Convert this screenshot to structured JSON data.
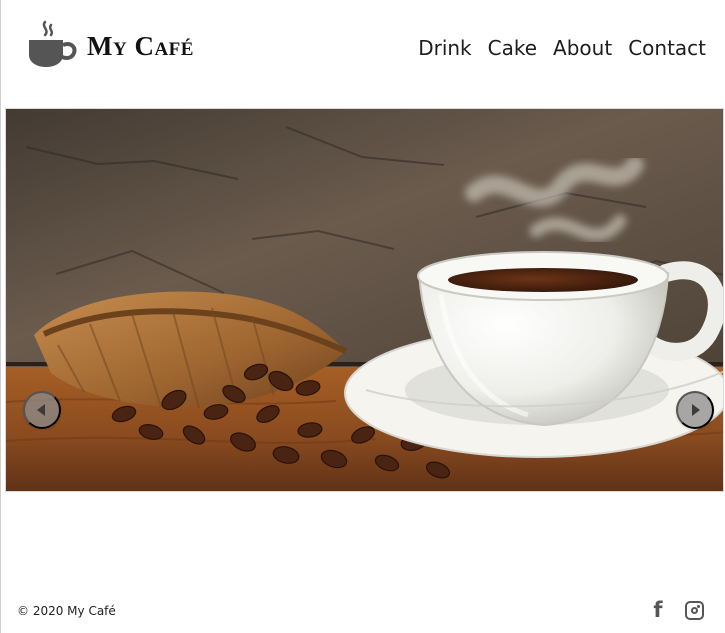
{
  "brand": {
    "name": "My Café"
  },
  "navigation": {
    "items": [
      {
        "label": "Drink"
      },
      {
        "label": "Cake"
      },
      {
        "label": "About"
      },
      {
        "label": "Contact"
      }
    ]
  },
  "hero": {
    "icons": {
      "previous": "chevron-left-icon",
      "next": "chevron-right-icon"
    }
  },
  "footer": {
    "copyright": "© 2020 My Café",
    "social": [
      {
        "icon": "facebook-icon"
      },
      {
        "icon": "instagram-icon"
      }
    ]
  },
  "colors": {
    "text": "#121212",
    "muted": "#555555",
    "hero_wall": "#5a4b3f",
    "hero_table": "#9a5a24"
  }
}
